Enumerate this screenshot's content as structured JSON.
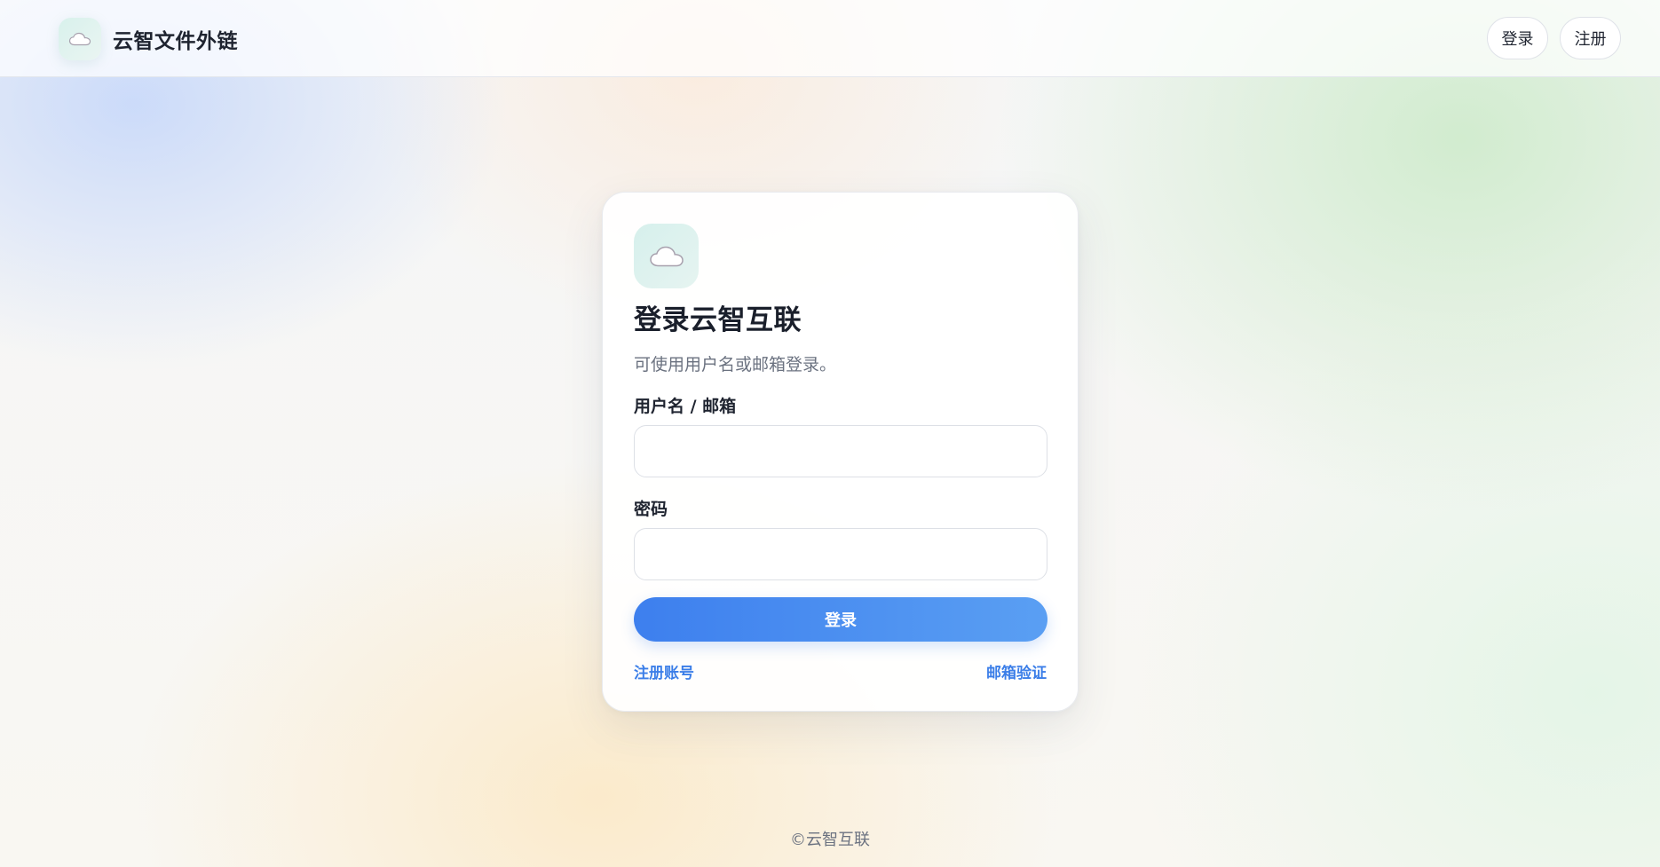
{
  "header": {
    "brand_name": "云智文件外链",
    "brand_icon": "cloud-icon",
    "nav_login_label": "登录",
    "nav_register_label": "注册"
  },
  "login_card": {
    "icon": "cloud-icon",
    "title": "登录云智互联",
    "subtitle": "可使用用户名或邮箱登录。",
    "username_label": "用户名 / 邮箱",
    "username_value": "",
    "username_placeholder": "",
    "password_label": "密码",
    "password_value": "",
    "password_placeholder": "",
    "submit_label": "登录",
    "register_link": "注册账号",
    "verify_link": "邮箱验证"
  },
  "footer": {
    "copyright": "©云智互联"
  },
  "colors": {
    "accent": "#3d7fee",
    "link": "#3b7ee8",
    "logo_bg": "#d8f1ec"
  }
}
